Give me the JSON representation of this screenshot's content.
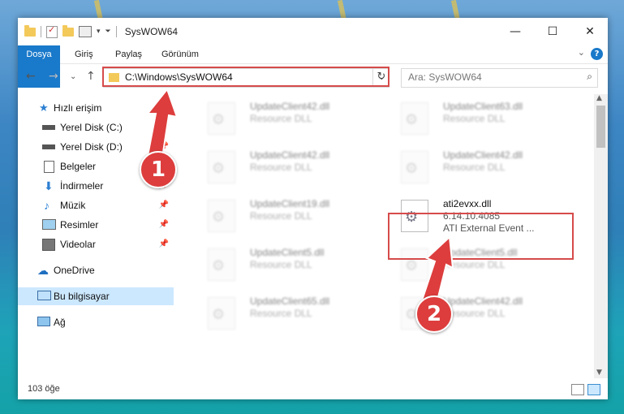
{
  "window": {
    "title": "SysWOW64"
  },
  "ribbon": {
    "tabs": [
      "Dosya",
      "Giriş",
      "Paylaş",
      "Görünüm"
    ]
  },
  "address": {
    "path": "C:\\Windows\\SysWOW64",
    "search_placeholder": "Ara: SysWOW64"
  },
  "sidebar": {
    "items": [
      {
        "label": "Hızlı erişim",
        "icon": "star-icon",
        "pinned": false
      },
      {
        "label": "Yerel Disk (C:)",
        "icon": "drive-icon",
        "pinned": true
      },
      {
        "label": "Yerel Disk (D:)",
        "icon": "drive-icon",
        "pinned": true
      },
      {
        "label": "Belgeler",
        "icon": "documents-icon",
        "pinned": true
      },
      {
        "label": "İndirmeler",
        "icon": "download-icon",
        "pinned": true
      },
      {
        "label": "Müzik",
        "icon": "music-icon",
        "pinned": true
      },
      {
        "label": "Resimler",
        "icon": "pictures-icon",
        "pinned": true
      },
      {
        "label": "Videolar",
        "icon": "video-icon",
        "pinned": true
      },
      {
        "label": "OneDrive",
        "icon": "cloud-icon",
        "pinned": false
      },
      {
        "label": "Bu bilgisayar",
        "icon": "computer-icon",
        "pinned": false
      },
      {
        "label": "Ağ",
        "icon": "network-icon",
        "pinned": false
      }
    ]
  },
  "files": [
    {
      "name": "UpdateClient42.dll",
      "type": "Resource DLL"
    },
    {
      "name": "UpdateClient63.dll",
      "type": "Resource DLL"
    },
    {
      "name": "UpdateClient42.dll",
      "type": "Resource DLL"
    },
    {
      "name": "UpdateClient42.dll",
      "type": "Resource DLL"
    },
    {
      "name": "UpdateClient19.dll",
      "type": "Resource DLL"
    },
    {
      "name": "ati2evxx.dll",
      "type": "6.14.10.4085",
      "desc": "ATI External Event ..."
    },
    {
      "name": "UpdateClient5.dll",
      "type": "Resource DLL"
    },
    {
      "name": "UpdateClient5.dll",
      "type": "Resource DLL"
    },
    {
      "name": "UpdateClient65.dll",
      "type": "Resource DLL"
    },
    {
      "name": "UpdateClient42.dll",
      "type": "Resource DLL"
    }
  ],
  "status": {
    "count": "103 öğe"
  },
  "annotations": {
    "step1": "1",
    "step2": "2",
    "color": "#dd3d3d"
  }
}
